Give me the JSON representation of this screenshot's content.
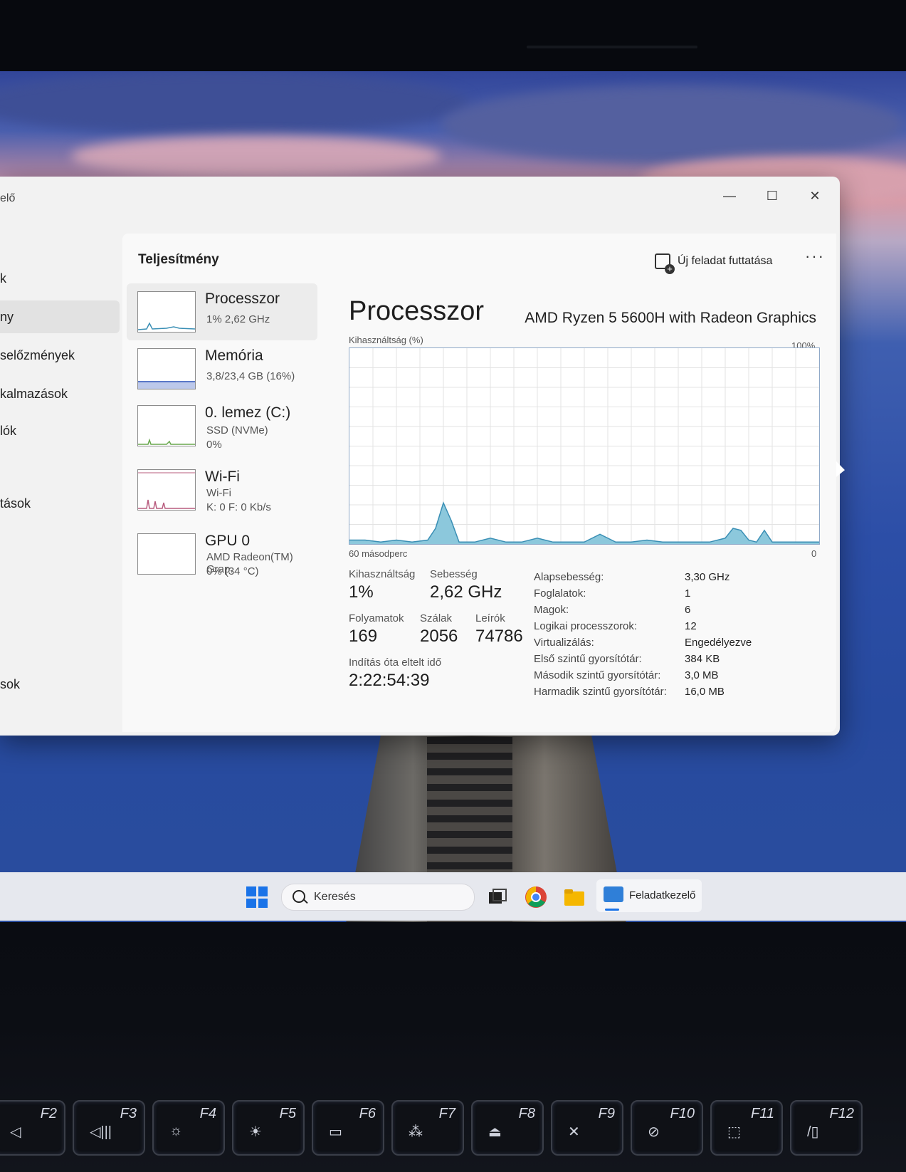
{
  "window": {
    "title_partial": "elő",
    "minimize": "—",
    "maximize": "☐",
    "close": "✕"
  },
  "nav": {
    "items": [
      {
        "label": "k"
      },
      {
        "label": "ny"
      },
      {
        "label": "selőzmények"
      },
      {
        "label": "kalmazások"
      },
      {
        "label": "lók"
      },
      {
        "label": "tások"
      },
      {
        "label": "sok"
      }
    ]
  },
  "header": {
    "title": "Teljesítmény",
    "new_task_label": "Új feladat futtatása",
    "more_label": "···"
  },
  "resources": [
    {
      "name": "Processzor",
      "sub1": "1% 2,62 GHz",
      "sub2": ""
    },
    {
      "name": "Memória",
      "sub1": "3,8/23,4 GB (16%)",
      "sub2": ""
    },
    {
      "name": "0. lemez (C:)",
      "sub1": "SSD (NVMe)",
      "sub2": "0%"
    },
    {
      "name": "Wi-Fi",
      "sub1": "Wi-Fi",
      "sub2": "K: 0 F: 0 Kb/s"
    },
    {
      "name": "GPU 0",
      "sub1": "AMD Radeon(TM) Grap.",
      "sub2": "0% (34 °C)"
    }
  ],
  "detail": {
    "title": "Processzor",
    "model": "AMD Ryzen 5 5600H with Radeon Graphics",
    "y_label": "Kihasználtság (%)",
    "y_max": "100%",
    "x_left": "60 másodperc",
    "x_right": "0"
  },
  "chart_data": {
    "type": "area",
    "ylabel": "Kihasználtság (%)",
    "ylim": [
      0,
      100
    ],
    "xlim": [
      60,
      0
    ],
    "x": [
      60,
      58,
      56,
      54,
      52,
      50,
      49,
      48,
      47,
      46,
      44,
      42,
      40,
      38,
      36,
      34,
      32,
      30,
      28,
      26,
      24,
      22,
      20,
      18,
      16,
      14,
      12,
      11,
      10,
      9,
      8,
      7,
      6,
      5,
      4,
      3,
      2,
      0
    ],
    "values": [
      2,
      2,
      1,
      2,
      1,
      2,
      8,
      21,
      12,
      1,
      1,
      3,
      1,
      1,
      3,
      1,
      1,
      1,
      5,
      1,
      1,
      2,
      1,
      1,
      1,
      1,
      3,
      8,
      7,
      2,
      1,
      7,
      1,
      1,
      1,
      1,
      1,
      1
    ],
    "grid": true
  },
  "stats": {
    "utilization_label": "Kihasználtság",
    "utilization_value": "1%",
    "speed_label": "Sebesség",
    "speed_value": "2,62 GHz",
    "processes_label": "Folyamatok",
    "processes_value": "169",
    "threads_label": "Szálak",
    "threads_value": "2056",
    "handles_label": "Leírók",
    "handles_value": "74786",
    "uptime_label": "Indítás óta eltelt idő",
    "uptime_value": "2:22:54:39"
  },
  "specs": [
    {
      "key": "Alapsebesség:",
      "value": "3,30 GHz"
    },
    {
      "key": "Foglalatok:",
      "value": "1"
    },
    {
      "key": "Magok:",
      "value": "6"
    },
    {
      "key": "Logikai processzorok:",
      "value": "12"
    },
    {
      "key": "Virtualizálás:",
      "value": "Engedélyezve"
    },
    {
      "key": "Első szintű gyorsítótár:",
      "value": "384 KB"
    },
    {
      "key": "Második szintű gyorsítótár:",
      "value": "3,0 MB"
    },
    {
      "key": "Harmadik szintű gyorsítótár:",
      "value": "16,0 MB"
    }
  ],
  "taskbar": {
    "search_placeholder": "Keresés",
    "active_app": "Feladatkezelő"
  },
  "keyboard": {
    "keys": [
      "F2",
      "F3",
      "F4",
      "F5",
      "F6",
      "F7",
      "F8",
      "F9",
      "F10",
      "F11",
      "F12"
    ]
  },
  "colors": {
    "chart_fill": "#8cc8dc",
    "chart_line": "#3a8fb5",
    "accent": "#1a73e8"
  }
}
